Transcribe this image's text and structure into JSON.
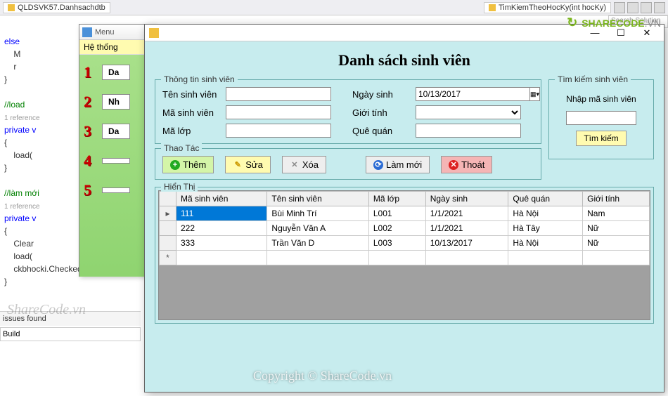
{
  "vs": {
    "breadcrumb1": "QLDSVK57.Danhsachdtb",
    "breadcrumb2": "TimKiemTheoHocKy(int hocKy)",
    "search_placeholder": "Search Solution"
  },
  "logo": {
    "text": "SHARECODE",
    "suffix": ".VN"
  },
  "code": {
    "l1": "else",
    "l2": "    M",
    "l3": "    r",
    "l4": "}",
    "l5": "",
    "l6": "//load",
    "ref1": "1 reference",
    "l7": "private v",
    "l8": "{",
    "l9": "    load(",
    "l10": "}",
    "l11": "",
    "l12": "//làm mới",
    "ref2": "1 reference",
    "l13": "private v",
    "l14": "{",
    "l15": "    Clear",
    "l16": "    load(",
    "l17": "    ckbhocki.Checked =",
    "l18": "}"
  },
  "bottom": {
    "issues": "issues found",
    "build": "Build"
  },
  "menu": {
    "title": "Menu",
    "menubar": "Hệ thống",
    "buttons": [
      "Da",
      "Nh",
      "Da",
      "",
      ""
    ]
  },
  "dialog": {
    "heading": "Danh sách sinh viên",
    "info_legend": "Thông tin sinh viên",
    "labels": {
      "ten": "Tên sinh viên",
      "ma": "Mã sinh viên",
      "lop": "Mã lớp",
      "ngay": "Ngày sinh",
      "gioi": "Giới tính",
      "que": "Quê quán"
    },
    "date_value": "10/13/2017",
    "search_legend": "Tìm kiếm sinh viên",
    "search_label": "Nhập mã sinh viên",
    "search_btn": "Tìm kiếm",
    "ops_legend": "Thao Tác",
    "btn_add": "Thêm",
    "btn_edit": "Sửa",
    "btn_del": "Xóa",
    "btn_refresh": "Làm mới",
    "btn_exit": "Thoát",
    "grid_legend": "Hiển Thị",
    "cols": [
      "Mã sinh viên",
      "Tên sinh viên",
      "Mã lớp",
      "Ngày sinh",
      "Quê quán",
      "Giới tính"
    ],
    "rows": [
      {
        "ma": "111",
        "ten": "Bùi Minh Trí",
        "lop": "L001",
        "ngay": "1/1/2021",
        "que": "Hà Nội",
        "gioi": "Nam"
      },
      {
        "ma": "222",
        "ten": "Nguyễn Văn A",
        "lop": "L002",
        "ngay": "1/1/2021",
        "que": "Hà Tây",
        "gioi": "Nữ"
      },
      {
        "ma": "333",
        "ten": "Trần Văn D",
        "lop": "L003",
        "ngay": "10/13/2017",
        "que": "Hà Nội",
        "gioi": "Nữ"
      }
    ]
  },
  "watermark1": "ShareCode.vn",
  "watermark2": "Copyright © ShareCode.vn"
}
